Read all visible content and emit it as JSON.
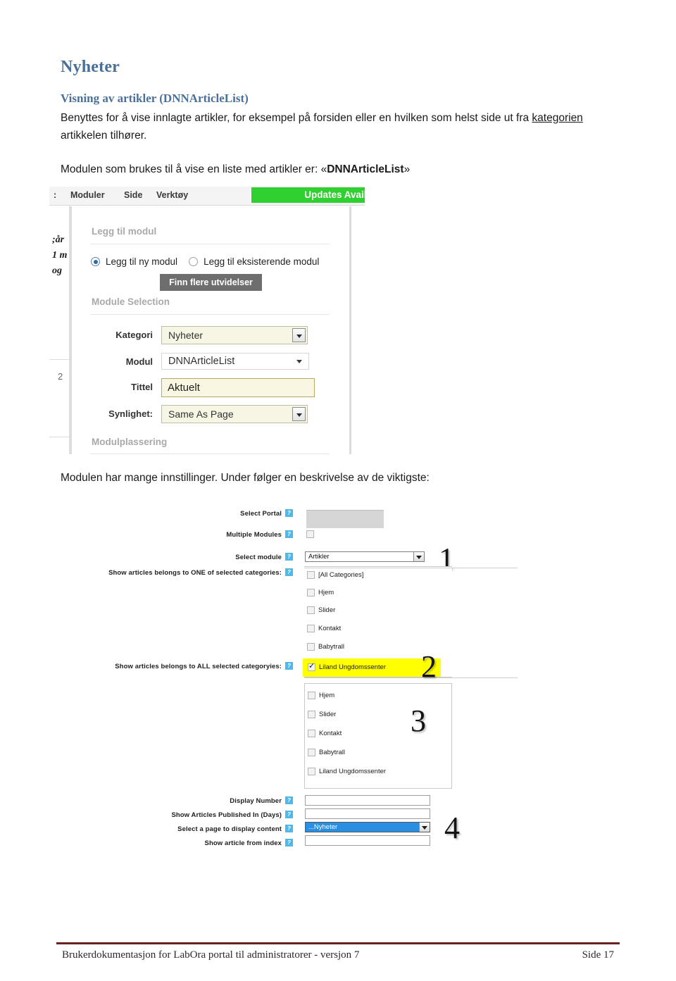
{
  "document": {
    "heading": "Nyheter",
    "subheading": "Visning av artikler (DNNArticleList)",
    "paragraph1_a": "Benyttes for å vise innlagte artikler, for eksempel på forsiden eller en hvilken som helst side ut fra ",
    "paragraph1_link": "kategorien",
    "paragraph1_b": " artikkelen tilhører.",
    "paragraph2_a": "Modulen som brukes til å vise en liste med artikler er: «",
    "paragraph2_bold": "DNNArticleList",
    "paragraph2_b": "»",
    "paragraph3": "Modulen har mange innstillinger. Under følger en beskrivelse av de viktigste:"
  },
  "screenshot_add_module": {
    "menubar": {
      "colon": ":",
      "items": [
        "Moduler",
        "Side",
        "Verktøy"
      ],
      "updates_banner": "Updates Availa"
    },
    "background_text": [
      ";år",
      "1 m",
      "og"
    ],
    "background_number": "2",
    "section_add_module": "Legg til modul",
    "radio_new": "Legg til ny modul",
    "radio_existing": "Legg til eksisterende modul",
    "find_extensions_button": "Finn flere utvidelser",
    "section_module_selection": "Module Selection",
    "section_module_placement": "Modulplassering",
    "fields": [
      {
        "label": "Kategori",
        "value": "Nyheter"
      },
      {
        "label": "Modul",
        "value": "DNNArticleList"
      },
      {
        "label": "Tittel",
        "value": "Aktuelt"
      },
      {
        "label": "Synlighet:",
        "value": "Same As Page"
      }
    ]
  },
  "screenshot_settings": {
    "labels": {
      "select_portal": "Select Portal",
      "multiple_modules": "Multiple Modules",
      "select_module": "Select module",
      "one_of_categories": "Show articles belongs to ONE of selected categories:",
      "all_categories_label": "Show articles belongs to ALL selected categoryies:",
      "display_number": "Display Number",
      "show_articles_published": "Show Articles Published In (Days)",
      "select_page": "Select a page to display content",
      "show_article_from_index": "Show article from index"
    },
    "help_icon": "?",
    "select_module_value": "Artikler",
    "select_page_value": "...Nyheter",
    "display_number_value": "",
    "show_articles_published_value": "",
    "show_article_from_index_value": "",
    "categories_one": [
      {
        "label": "[All Categories]",
        "checked": false,
        "highlight": false
      },
      {
        "label": "Hjem",
        "checked": false,
        "highlight": false
      },
      {
        "label": "Slider",
        "checked": false,
        "highlight": false
      },
      {
        "label": "Kontakt",
        "checked": false,
        "highlight": false
      },
      {
        "label": "Babytrall",
        "checked": false,
        "highlight": false
      },
      {
        "label": "Liland Ungdomssenter",
        "checked": true,
        "highlight": true
      }
    ],
    "categories_all": [
      {
        "label": "Hjem",
        "checked": false
      },
      {
        "label": "Slider",
        "checked": false
      },
      {
        "label": "Kontakt",
        "checked": false
      },
      {
        "label": "Babytrall",
        "checked": false
      },
      {
        "label": "Liland Ungdomssenter",
        "checked": false
      }
    ],
    "annotations": [
      "1",
      "2",
      "3",
      "4"
    ],
    "colors": {
      "highlight": "#ffff00",
      "selection": "#2a8fe0",
      "help": "#4eb8e8"
    }
  },
  "footer": {
    "text": "Brukerdokumentasjon for LabOra portal til administratorer - versjon 7",
    "page": "Side 17",
    "rule_color": "#6b2222"
  }
}
